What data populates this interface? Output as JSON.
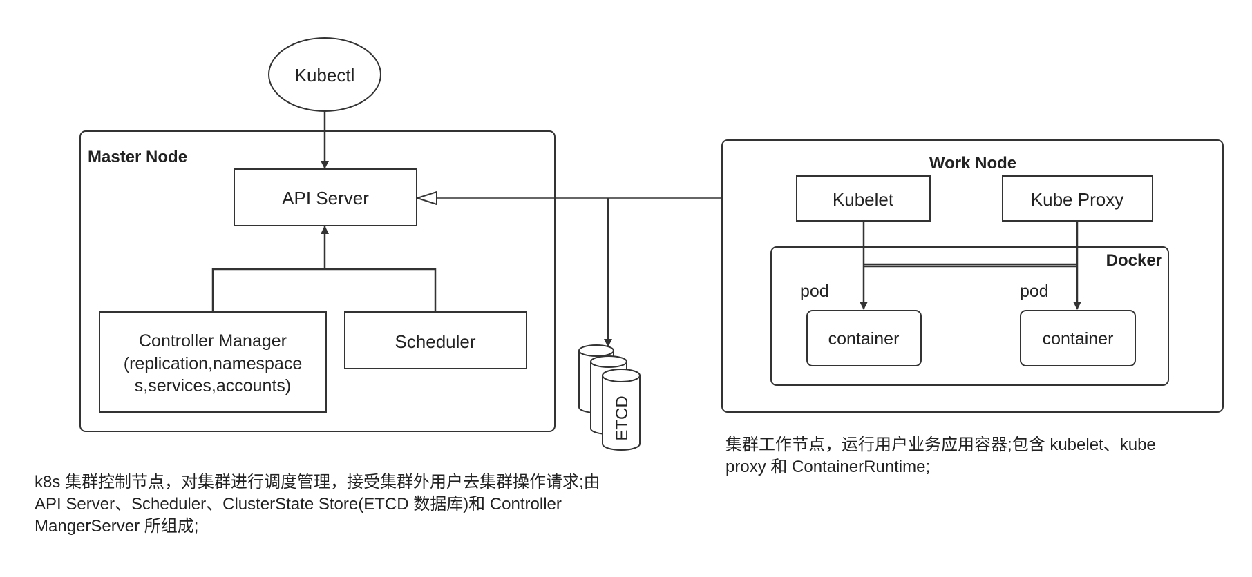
{
  "diagram": {
    "client": "Kubectl",
    "master": {
      "title": "Master Node",
      "api_server": "API Server",
      "controller_manager": [
        "Controller Manager",
        "(replication,namespace",
        "s,services,accounts)"
      ],
      "scheduler": "Scheduler"
    },
    "storage": "ETCD",
    "worker": {
      "title": "Work Node",
      "kubelet": "Kubelet",
      "kube_proxy": "Kube Proxy",
      "runtime": "Docker",
      "pods": [
        {
          "label": "pod",
          "container": "container"
        },
        {
          "label": "pod",
          "container": "container"
        }
      ]
    }
  },
  "notes": {
    "master_lines": [
      "k8s 集群控制节点，对集群进行调度管理，接受集群外用户去集群操作请求;由",
      "API Server、Scheduler、ClusterState Store(ETCD 数据库)和 Controller",
      "MangerServer 所组成;"
    ],
    "worker_lines": [
      "集群工作节点，运行用户业务应用容器;包含 kubelet、kube",
      "proxy 和 ContainerRuntime;"
    ]
  }
}
